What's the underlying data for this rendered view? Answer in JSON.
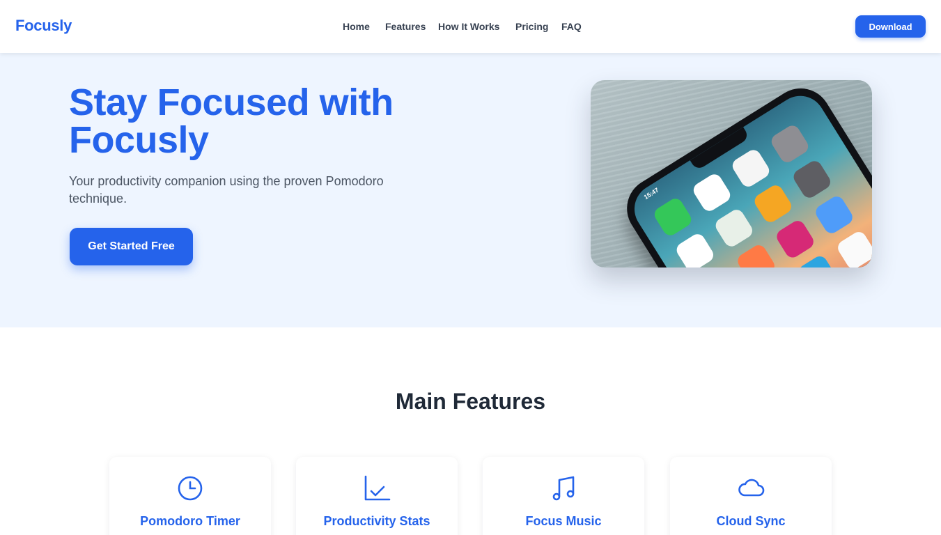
{
  "header": {
    "logo": "Focusly",
    "nav": [
      "Home",
      "Features",
      "How It Works",
      "Pricing",
      "FAQ"
    ],
    "download_label": "Download"
  },
  "hero": {
    "title": "Stay Focused with Focusly",
    "subtitle": "Your productivity companion using the proven Pomodoro technique.",
    "cta_label": "Get Started Free",
    "phone_time": "15:47"
  },
  "features": {
    "title": "Main Features",
    "cards": [
      {
        "title": "Pomodoro Timer",
        "icon": "clock-icon"
      },
      {
        "title": "Productivity Stats",
        "icon": "chart-check-icon"
      },
      {
        "title": "Focus Music",
        "icon": "music-note-icon"
      },
      {
        "title": "Cloud Sync",
        "icon": "cloud-icon"
      }
    ]
  },
  "colors": {
    "brand": "#2563eb",
    "hero_bg": "#eef5ff",
    "text_dark": "#1f2937",
    "text_muted": "#4b5563"
  }
}
